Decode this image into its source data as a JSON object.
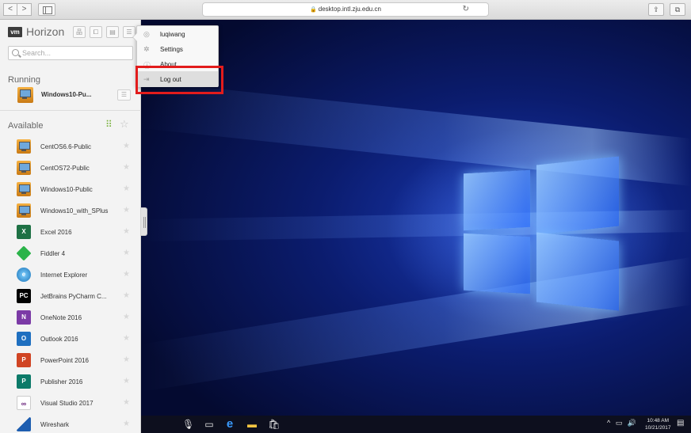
{
  "browser": {
    "back_icon": "<",
    "forward_icon": ">",
    "url": "desktop.intl.zju.edu.cn",
    "lock_glyph": "🔒",
    "reload_glyph": "↻",
    "share_glyph": "⇪",
    "tabs_glyph": "⧉"
  },
  "sidebar": {
    "logo": "vm",
    "title": "Horizon",
    "tools": [
      {
        "name": "connect-server-button",
        "glyph": "品"
      },
      {
        "name": "clipboard-button",
        "glyph": "⧠"
      },
      {
        "name": "file-transfer-button",
        "glyph": "▤"
      },
      {
        "name": "settings-menu-button",
        "glyph": "☰"
      }
    ],
    "search_placeholder": "Search...",
    "running_title": "Running",
    "running": [
      {
        "label": "Windows10-Pu...",
        "icon": "vm-desktop-icon",
        "menu_glyph": "☰"
      }
    ],
    "available_title": "Available",
    "grid_glyph": "⠿",
    "star_glyph": "☆",
    "fav_glyph": "★",
    "available": [
      {
        "label": "CentOS6.6-Public",
        "icon": "vm-desktop-icon",
        "icon_text": ""
      },
      {
        "label": "CentOS72-Public",
        "icon": "vm-desktop-icon",
        "icon_text": ""
      },
      {
        "label": "Windows10-Public",
        "icon": "vm-desktop-icon",
        "icon_text": ""
      },
      {
        "label": "Windows10_with_SPlus",
        "icon": "vm-desktop-icon",
        "icon_text": ""
      },
      {
        "label": "Excel 2016",
        "icon": "excel-icon",
        "icon_text": "X"
      },
      {
        "label": "Fiddler 4",
        "icon": "fiddler-icon",
        "icon_text": ""
      },
      {
        "label": "Internet Explorer",
        "icon": "internet-explorer-icon",
        "icon_text": "e"
      },
      {
        "label": "JetBrains PyCharm C...",
        "icon": "pycharm-icon",
        "icon_text": "PC"
      },
      {
        "label": "OneNote 2016",
        "icon": "onenote-icon",
        "icon_text": "N"
      },
      {
        "label": "Outlook 2016",
        "icon": "outlook-icon",
        "icon_text": "O"
      },
      {
        "label": "PowerPoint 2016",
        "icon": "powerpoint-icon",
        "icon_text": "P"
      },
      {
        "label": "Publisher 2016",
        "icon": "publisher-icon",
        "icon_text": "P"
      },
      {
        "label": "Visual Studio 2017",
        "icon": "visual-studio-icon",
        "icon_text": "∞"
      },
      {
        "label": "Wireshark",
        "icon": "wireshark-icon",
        "icon_text": ""
      }
    ]
  },
  "menu": {
    "items": [
      {
        "label": "luqiwang",
        "icon": "user-icon",
        "glyph": "◎"
      },
      {
        "label": "Settings",
        "icon": "gear-icon",
        "glyph": "✲"
      },
      {
        "label": "About",
        "icon": "info-icon",
        "glyph": "ⓘ"
      },
      {
        "label": "Log out",
        "icon": "logout-icon",
        "glyph": "⇥"
      }
    ]
  },
  "taskbar": {
    "mic_glyph": "🎙",
    "taskview_glyph": "▭",
    "edge_glyph": "e",
    "explorer_glyph": "▬",
    "store_glyph": "🛍",
    "tray_glyphs": "^ ▭ 🔊",
    "time": "10:48 AM",
    "date": "10/21/2017",
    "notify_glyph": "▤"
  },
  "colors": {
    "highlight": "#e21c1c",
    "horizon_accent": "#7cb342",
    "desktop_blue": "#1a3bb8"
  }
}
